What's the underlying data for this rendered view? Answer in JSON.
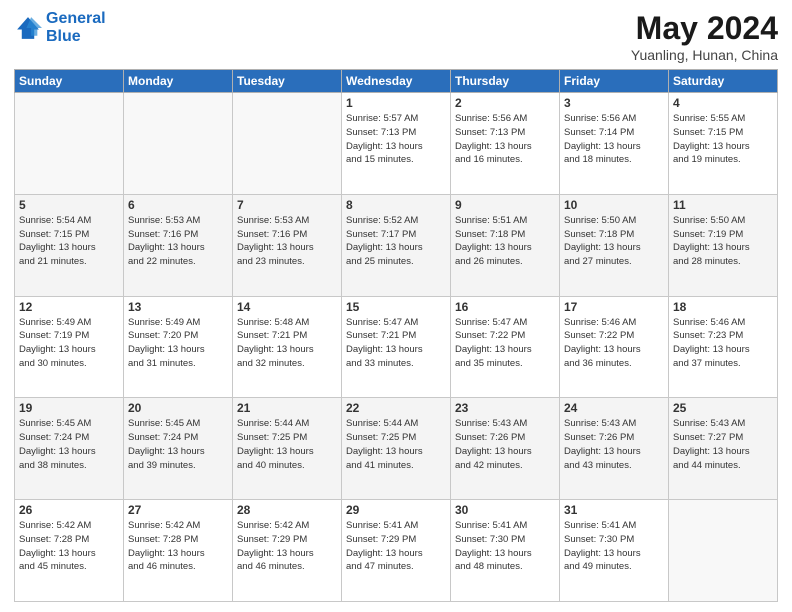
{
  "logo": {
    "line1": "General",
    "line2": "Blue"
  },
  "title": "May 2024",
  "subtitle": "Yuanling, Hunan, China",
  "days_header": [
    "Sunday",
    "Monday",
    "Tuesday",
    "Wednesday",
    "Thursday",
    "Friday",
    "Saturday"
  ],
  "weeks": [
    [
      {
        "day": "",
        "info": ""
      },
      {
        "day": "",
        "info": ""
      },
      {
        "day": "",
        "info": ""
      },
      {
        "day": "1",
        "info": "Sunrise: 5:57 AM\nSunset: 7:13 PM\nDaylight: 13 hours\nand 15 minutes."
      },
      {
        "day": "2",
        "info": "Sunrise: 5:56 AM\nSunset: 7:13 PM\nDaylight: 13 hours\nand 16 minutes."
      },
      {
        "day": "3",
        "info": "Sunrise: 5:56 AM\nSunset: 7:14 PM\nDaylight: 13 hours\nand 18 minutes."
      },
      {
        "day": "4",
        "info": "Sunrise: 5:55 AM\nSunset: 7:15 PM\nDaylight: 13 hours\nand 19 minutes."
      }
    ],
    [
      {
        "day": "5",
        "info": "Sunrise: 5:54 AM\nSunset: 7:15 PM\nDaylight: 13 hours\nand 21 minutes."
      },
      {
        "day": "6",
        "info": "Sunrise: 5:53 AM\nSunset: 7:16 PM\nDaylight: 13 hours\nand 22 minutes."
      },
      {
        "day": "7",
        "info": "Sunrise: 5:53 AM\nSunset: 7:16 PM\nDaylight: 13 hours\nand 23 minutes."
      },
      {
        "day": "8",
        "info": "Sunrise: 5:52 AM\nSunset: 7:17 PM\nDaylight: 13 hours\nand 25 minutes."
      },
      {
        "day": "9",
        "info": "Sunrise: 5:51 AM\nSunset: 7:18 PM\nDaylight: 13 hours\nand 26 minutes."
      },
      {
        "day": "10",
        "info": "Sunrise: 5:50 AM\nSunset: 7:18 PM\nDaylight: 13 hours\nand 27 minutes."
      },
      {
        "day": "11",
        "info": "Sunrise: 5:50 AM\nSunset: 7:19 PM\nDaylight: 13 hours\nand 28 minutes."
      }
    ],
    [
      {
        "day": "12",
        "info": "Sunrise: 5:49 AM\nSunset: 7:19 PM\nDaylight: 13 hours\nand 30 minutes."
      },
      {
        "day": "13",
        "info": "Sunrise: 5:49 AM\nSunset: 7:20 PM\nDaylight: 13 hours\nand 31 minutes."
      },
      {
        "day": "14",
        "info": "Sunrise: 5:48 AM\nSunset: 7:21 PM\nDaylight: 13 hours\nand 32 minutes."
      },
      {
        "day": "15",
        "info": "Sunrise: 5:47 AM\nSunset: 7:21 PM\nDaylight: 13 hours\nand 33 minutes."
      },
      {
        "day": "16",
        "info": "Sunrise: 5:47 AM\nSunset: 7:22 PM\nDaylight: 13 hours\nand 35 minutes."
      },
      {
        "day": "17",
        "info": "Sunrise: 5:46 AM\nSunset: 7:22 PM\nDaylight: 13 hours\nand 36 minutes."
      },
      {
        "day": "18",
        "info": "Sunrise: 5:46 AM\nSunset: 7:23 PM\nDaylight: 13 hours\nand 37 minutes."
      }
    ],
    [
      {
        "day": "19",
        "info": "Sunrise: 5:45 AM\nSunset: 7:24 PM\nDaylight: 13 hours\nand 38 minutes."
      },
      {
        "day": "20",
        "info": "Sunrise: 5:45 AM\nSunset: 7:24 PM\nDaylight: 13 hours\nand 39 minutes."
      },
      {
        "day": "21",
        "info": "Sunrise: 5:44 AM\nSunset: 7:25 PM\nDaylight: 13 hours\nand 40 minutes."
      },
      {
        "day": "22",
        "info": "Sunrise: 5:44 AM\nSunset: 7:25 PM\nDaylight: 13 hours\nand 41 minutes."
      },
      {
        "day": "23",
        "info": "Sunrise: 5:43 AM\nSunset: 7:26 PM\nDaylight: 13 hours\nand 42 minutes."
      },
      {
        "day": "24",
        "info": "Sunrise: 5:43 AM\nSunset: 7:26 PM\nDaylight: 13 hours\nand 43 minutes."
      },
      {
        "day": "25",
        "info": "Sunrise: 5:43 AM\nSunset: 7:27 PM\nDaylight: 13 hours\nand 44 minutes."
      }
    ],
    [
      {
        "day": "26",
        "info": "Sunrise: 5:42 AM\nSunset: 7:28 PM\nDaylight: 13 hours\nand 45 minutes."
      },
      {
        "day": "27",
        "info": "Sunrise: 5:42 AM\nSunset: 7:28 PM\nDaylight: 13 hours\nand 46 minutes."
      },
      {
        "day": "28",
        "info": "Sunrise: 5:42 AM\nSunset: 7:29 PM\nDaylight: 13 hours\nand 46 minutes."
      },
      {
        "day": "29",
        "info": "Sunrise: 5:41 AM\nSunset: 7:29 PM\nDaylight: 13 hours\nand 47 minutes."
      },
      {
        "day": "30",
        "info": "Sunrise: 5:41 AM\nSunset: 7:30 PM\nDaylight: 13 hours\nand 48 minutes."
      },
      {
        "day": "31",
        "info": "Sunrise: 5:41 AM\nSunset: 7:30 PM\nDaylight: 13 hours\nand 49 minutes."
      },
      {
        "day": "",
        "info": ""
      }
    ]
  ]
}
